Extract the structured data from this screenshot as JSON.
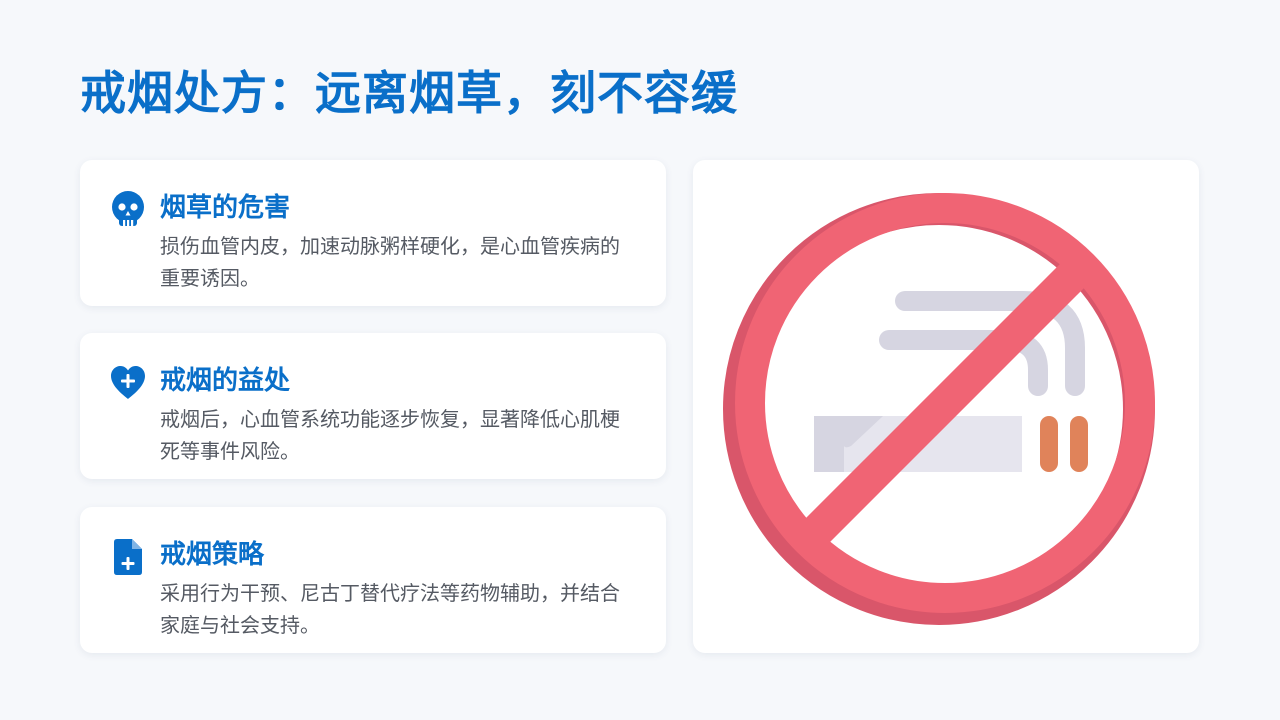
{
  "title": "戒烟处方：远离烟草，刻不容缓",
  "cards": [
    {
      "icon": "skull-icon",
      "title": "烟草的危害",
      "body": "损伤血管内皮，加速动脉粥样硬化，是心血管疾病的重要诱因。"
    },
    {
      "icon": "heart-plus-icon",
      "title": "戒烟的益处",
      "body": "戒烟后，心血管系统功能逐步恢复，显著降低心肌梗死等事件风险。"
    },
    {
      "icon": "file-plus-icon",
      "title": "戒烟策略",
      "body": "采用行为干预、尼古丁替代疗法等药物辅助，并结合家庭与社会支持。"
    }
  ],
  "illustration": {
    "icon": "no-smoking-icon"
  },
  "colors": {
    "accent": "#0a6fc9",
    "background": "#f6f8fb",
    "card": "#ffffff",
    "body_text": "#555a63",
    "prohibition_red": "#f06474",
    "prohibition_shade": "#d9566a",
    "smoke_gray": "#d6d5e1",
    "cigarette_tip": "#e0835a"
  }
}
